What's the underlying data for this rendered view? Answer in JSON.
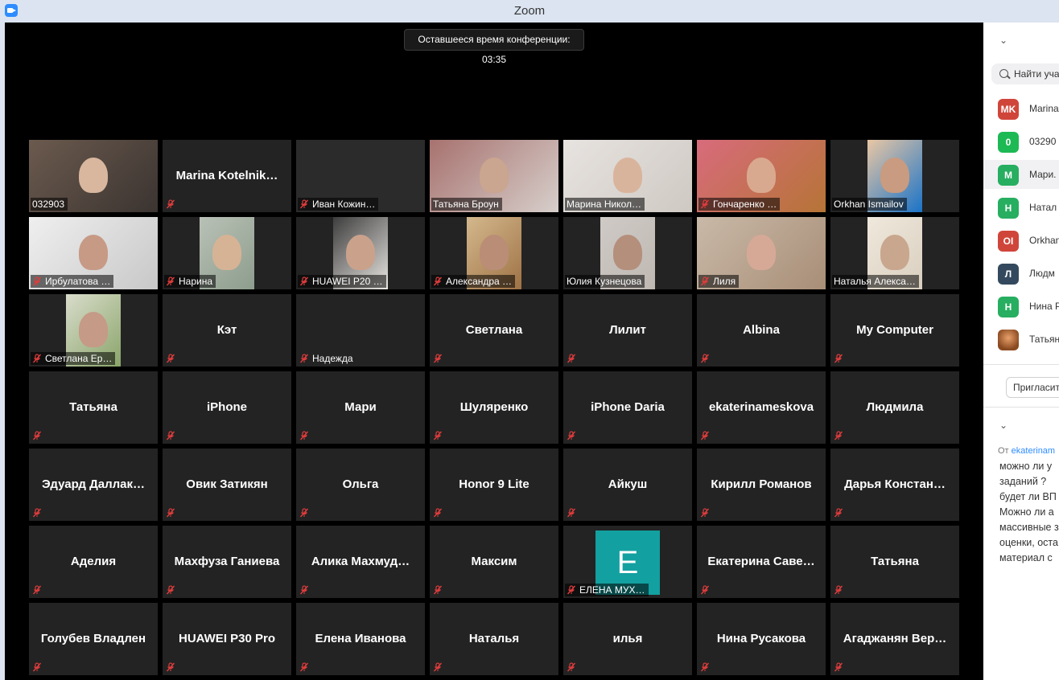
{
  "window": {
    "title": "Zoom"
  },
  "meeting": {
    "timer_text": "Оставшееся время конференции: 03:35"
  },
  "colors": {
    "active_speaker_border": "#d6d957",
    "muted_icon": "#e03c3c",
    "tile_bg": "#232323",
    "accent_blue": "#2d8cff"
  },
  "grid": {
    "rows": [
      [
        {
          "label": "032903",
          "video": true,
          "muted": false
        },
        {
          "label": "Marina  Kotelnik…",
          "video": false,
          "muted": true
        },
        {
          "label": "Иван Кожин…",
          "video": true,
          "muted": true
        },
        {
          "label": "Татьяна Броун",
          "video": true,
          "muted": false
        },
        {
          "label": "Марина Никол…",
          "video": true,
          "muted": false,
          "active": true
        },
        {
          "label": "Гончаренко …",
          "video": true,
          "muted": true
        },
        {
          "label": "Orkhan Ismailov",
          "video": true,
          "muted": false
        }
      ],
      [
        {
          "label": "Ирбулатова …",
          "video": true,
          "muted": true
        },
        {
          "label": "Нарина",
          "video": true,
          "muted": true
        },
        {
          "label": "HUAWEI P20 …",
          "video": true,
          "muted": true
        },
        {
          "label": "Александра …",
          "video": true,
          "muted": true
        },
        {
          "label": "Юлия Кузнецова",
          "video": true,
          "muted": false
        },
        {
          "label": "Лиля",
          "video": true,
          "muted": true
        },
        {
          "label": "Наталья Алекса…",
          "video": true,
          "muted": false
        }
      ],
      [
        {
          "label": "Светлана Ер…",
          "video": true,
          "muted": true
        },
        {
          "label": "Кэт",
          "video": false,
          "muted": true
        },
        {
          "label": "Надежда",
          "video": false,
          "muted": true,
          "name_bottom_only": true
        },
        {
          "label": "Светлана",
          "video": false,
          "muted": true
        },
        {
          "label": "Лилит",
          "video": false,
          "muted": true
        },
        {
          "label": "Albina",
          "video": false,
          "muted": true
        },
        {
          "label": "My Computer",
          "video": false,
          "muted": true
        }
      ],
      [
        {
          "label": "Татьяна",
          "video": false,
          "muted": true
        },
        {
          "label": "iPhone",
          "video": false,
          "muted": true
        },
        {
          "label": "Мари",
          "video": false,
          "muted": true
        },
        {
          "label": "Шуляренко",
          "video": false,
          "muted": true
        },
        {
          "label": "iPhone Daria",
          "video": false,
          "muted": true
        },
        {
          "label": "ekaterinameskova",
          "video": false,
          "muted": true
        },
        {
          "label": "Людмила",
          "video": false,
          "muted": true
        }
      ],
      [
        {
          "label": "Эдуард  Даллак…",
          "video": false,
          "muted": true
        },
        {
          "label": "Овик Затикян",
          "video": false,
          "muted": true
        },
        {
          "label": "Ольга",
          "video": false,
          "muted": true
        },
        {
          "label": "Honor 9 Lite",
          "video": false,
          "muted": true
        },
        {
          "label": "Айкуш",
          "video": false,
          "muted": true
        },
        {
          "label": "Кирилл Романов",
          "video": false,
          "muted": true
        },
        {
          "label": "Дарья  Констан…",
          "video": false,
          "muted": true
        }
      ],
      [
        {
          "label": "Аделия",
          "video": false,
          "muted": true
        },
        {
          "label": "Махфуза Ганиева",
          "video": false,
          "muted": true
        },
        {
          "label": "Алика  Махмуд…",
          "video": false,
          "muted": true
        },
        {
          "label": "Максим",
          "video": false,
          "muted": true
        },
        {
          "label": "ЕЛЕНА МУХ…",
          "video": false,
          "muted": true,
          "avatar": "E"
        },
        {
          "label": "Екатерина  Саве…",
          "video": false,
          "muted": true
        },
        {
          "label": "Татьяна",
          "video": false,
          "muted": true
        }
      ],
      [
        {
          "label": "Голубев Владлен",
          "video": false,
          "muted": true
        },
        {
          "label": "HUAWEI P30 Pro",
          "video": false,
          "muted": true
        },
        {
          "label": "Елена Иванова",
          "video": false,
          "muted": true
        },
        {
          "label": "Наталья",
          "video": false,
          "muted": true
        },
        {
          "label": "илья",
          "video": false,
          "muted": true
        },
        {
          "label": "Нина Русакова",
          "video": false,
          "muted": true
        },
        {
          "label": "Агаджанян  Вер…",
          "video": false,
          "muted": true
        }
      ]
    ]
  },
  "participants_panel": {
    "search_placeholder": "Найти уча",
    "items": [
      {
        "initials": "MK",
        "name": "Marina",
        "color": "#d0453a"
      },
      {
        "initials": "0",
        "name": "03290",
        "color": "#1db954"
      },
      {
        "initials": "M",
        "name": "Мари.",
        "color": "#27ae60",
        "highlight": true
      },
      {
        "initials": "Н",
        "name": "Натал",
        "color": "#27ae60"
      },
      {
        "initials": "OI",
        "name": "Orkhan",
        "color": "#d0453a"
      },
      {
        "initials": "Л",
        "name": "Людм",
        "color": "#34495e"
      },
      {
        "initials": "Н",
        "name": "Нина Р",
        "color": "#27ae60"
      },
      {
        "initials": "",
        "name": "Татьян",
        "color": "#b5651d",
        "photo": true
      }
    ],
    "invite_label": "Пригласит"
  },
  "chat_panel": {
    "from_prefix": "От",
    "from_name": "ekaterinam",
    "lines": [
      "можно ли у",
      "заданий ?",
      "будет ли ВП",
      "Можно ли а",
      "массивные з",
      "оценки, оста",
      "материал с"
    ]
  }
}
